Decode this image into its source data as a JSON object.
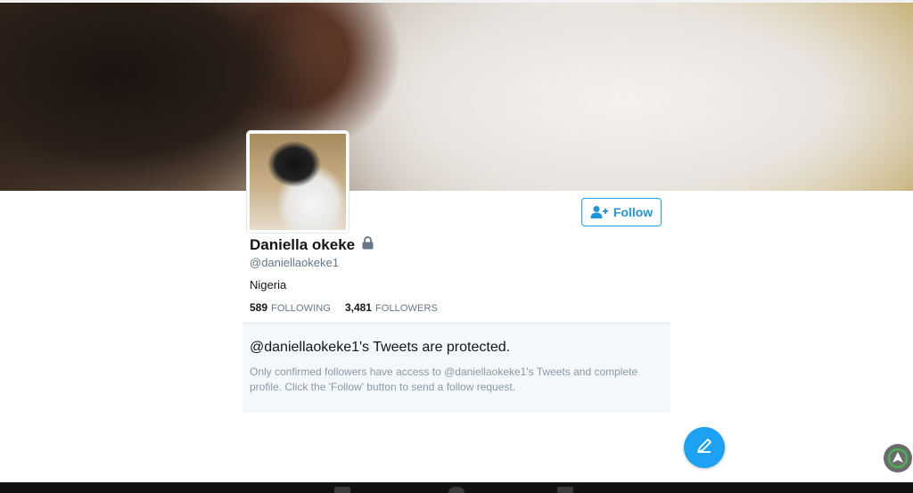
{
  "profile": {
    "name": "Daniella okeke",
    "handle": "@daniellaokeke1",
    "location": "Nigeria",
    "protected_icon": "lock-icon",
    "avatar_icon": "profile-photo"
  },
  "actions": {
    "follow_label": "Follow",
    "follow_icon": "add-user-icon",
    "compose_icon": "compose-tweet-icon"
  },
  "stats": {
    "following_count": "589",
    "following_label": "FOLLOWING",
    "followers_count": "3,481",
    "followers_label": "FOLLOWERS"
  },
  "protected_notice": {
    "title": "@daniellaokeke1's Tweets are protected.",
    "body": "Only confirmed followers have access to @daniellaokeke1's Tweets and complete profile. Click the 'Follow' button to send a follow request."
  },
  "colors": {
    "accent": "#1da1f2",
    "text_primary": "#14171a",
    "text_secondary": "#657786",
    "panel_bg": "#f5f8fa"
  }
}
